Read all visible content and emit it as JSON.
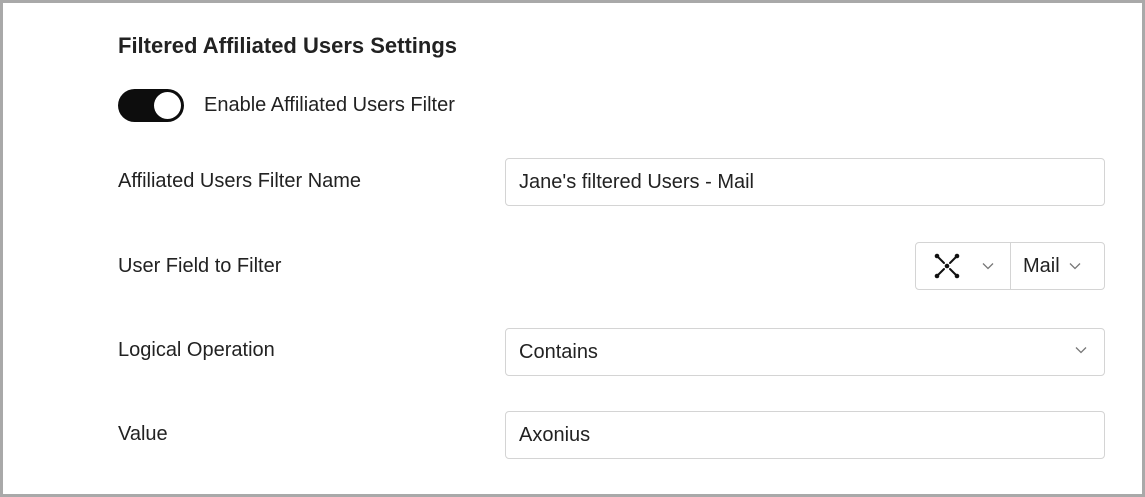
{
  "section": {
    "title": "Filtered Affiliated Users Settings"
  },
  "toggle": {
    "label": "Enable Affiliated Users Filter",
    "enabled": true,
    "on_color": "#0d0d0d"
  },
  "fields": {
    "filter_name": {
      "label": "Affiliated Users Filter Name",
      "value": "Jane's filtered Users  - Mail"
    },
    "user_field": {
      "label": "User Field to Filter",
      "adapter_icon": "all-adapters-icon",
      "value": "Mail"
    },
    "logical_operation": {
      "label": "Logical Operation",
      "value": "Contains"
    },
    "value": {
      "label": "Value",
      "value": "Axonius"
    }
  },
  "icons": {
    "dropdown": "chevron-down-icon"
  }
}
